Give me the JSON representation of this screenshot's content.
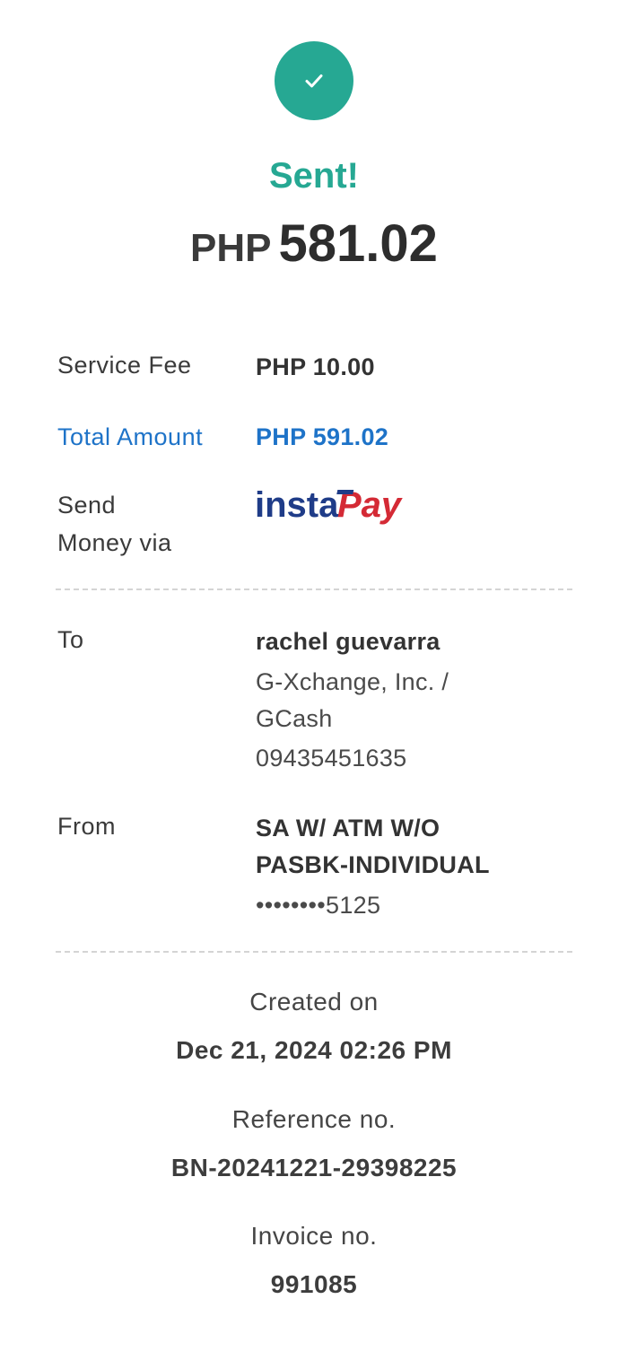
{
  "status": {
    "icon": "check-icon",
    "title": "Sent!",
    "color": "#26a893"
  },
  "amount": {
    "currency": "PHP",
    "value": "581.02"
  },
  "details": {
    "service_fee_label": "Service Fee",
    "service_fee_value": "PHP 10.00",
    "total_label": "Total Amount",
    "total_value": "PHP 591.02",
    "total_color": "#1e73c8",
    "via_label_line1": "Send",
    "via_label_line2": "Money via",
    "via_logo": {
      "text_part1": "insta",
      "text_part2": "Pay",
      "icon": "instapay-logo"
    }
  },
  "recipient": {
    "label": "To",
    "name": "rachel guevarra",
    "bank_line1": "G-Xchange, Inc. /",
    "bank_line2": "GCash",
    "account": "09435451635"
  },
  "sender": {
    "label": "From",
    "account_type_line1": "SA W/ ATM W/O",
    "account_type_line2": "PASBK-INDIVIDUAL",
    "account_masked": "••••••••5125"
  },
  "meta": {
    "created_label": "Created on",
    "created_value": "Dec 21, 2024 02:26 PM",
    "reference_label": "Reference no.",
    "reference_value": "BN-20241221-29398225",
    "invoice_label": "Invoice no.",
    "invoice_value": "991085"
  }
}
